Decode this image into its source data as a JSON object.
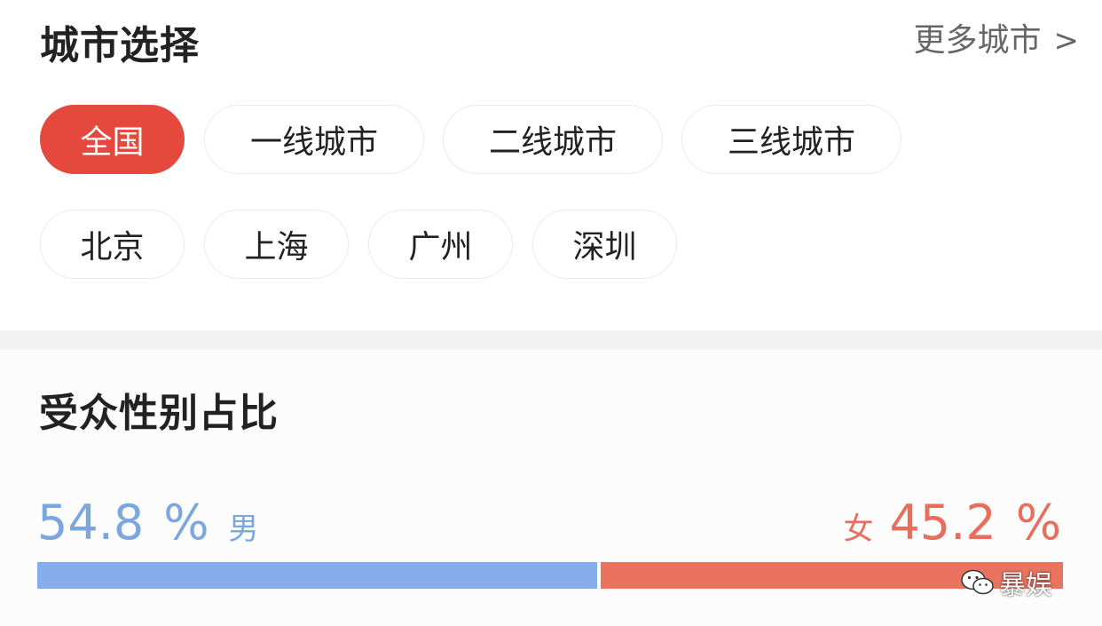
{
  "city_select": {
    "title": "城市选择",
    "more_label": "更多城市",
    "more_chevron": ">",
    "tiers": [
      "全国",
      "一线城市",
      "二线城市",
      "三线城市"
    ],
    "cities": [
      "北京",
      "上海",
      "广州",
      "深圳"
    ],
    "active": "全国"
  },
  "gender": {
    "title": "受众性别占比",
    "male": {
      "value": "54.8",
      "unit": "%",
      "label": "男",
      "fraction": 0.548
    },
    "female": {
      "value": "45.2",
      "unit": "%",
      "label": "女",
      "fraction": 0.452
    }
  },
  "watermark": {
    "text": "暴娱",
    "icon": "wechat-icon"
  },
  "colors": {
    "accent_red": "#e5493e",
    "male_blue": "#84ade9",
    "female_coral": "#ea735f"
  }
}
